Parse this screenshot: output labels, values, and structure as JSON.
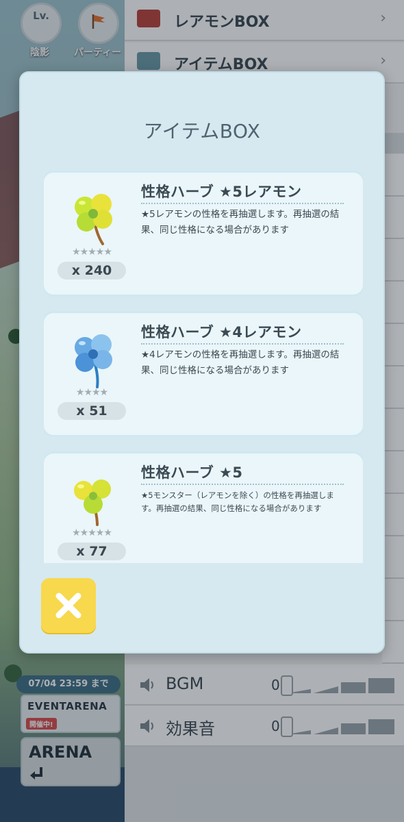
{
  "hud": {
    "shadow_label": "陰影",
    "party_label": "パーティー",
    "level_badge": "Lv."
  },
  "menu": {
    "items": [
      {
        "label": "レアモンBOX",
        "icon_color": "#b8433b"
      },
      {
        "label": "アイテムBOX",
        "icon_color": "#6a9aa8"
      }
    ],
    "sliders": [
      {
        "label": "BGM",
        "value": "0"
      },
      {
        "label": "効果音",
        "value": "0"
      }
    ]
  },
  "event": {
    "deadline": "07/04 23:59 まで",
    "title": "EVENTARENA",
    "live_badge": "開催中!",
    "arena_title": "ARENA",
    "arena_enter_icon": "enter-arrow-icon"
  },
  "modal": {
    "title": "アイテムBOX",
    "items": [
      {
        "name": "性格ハーブ ★5レアモン",
        "description": "★5レアモンの性格を再抽選します。再抽選の結果、同じ性格になる場合があります",
        "quantity": "x 240",
        "stars": "★★★★★",
        "icon": "yellow-green-clover-icon"
      },
      {
        "name": "性格ハーブ ★4レアモン",
        "description": "★4レアモンの性格を再抽選します。再抽選の結果、同じ性格になる場合があります",
        "quantity": "x 51",
        "stars": "★★★★",
        "icon": "blue-clover-icon"
      },
      {
        "name": "性格ハーブ ★5",
        "description": "★5モンスター（レアモンを除く）の性格を再抽選します。再抽選の結果、同じ性格になる場合があります",
        "quantity": "x 77",
        "stars": "★★★★★",
        "icon": "yellow-clover-icon"
      }
    ],
    "close_icon": "close-x-icon"
  },
  "colors": {
    "modal_bg": "#d6e9f0",
    "card_bg": "#eaf6f9",
    "close_button": "#f8d84c"
  }
}
